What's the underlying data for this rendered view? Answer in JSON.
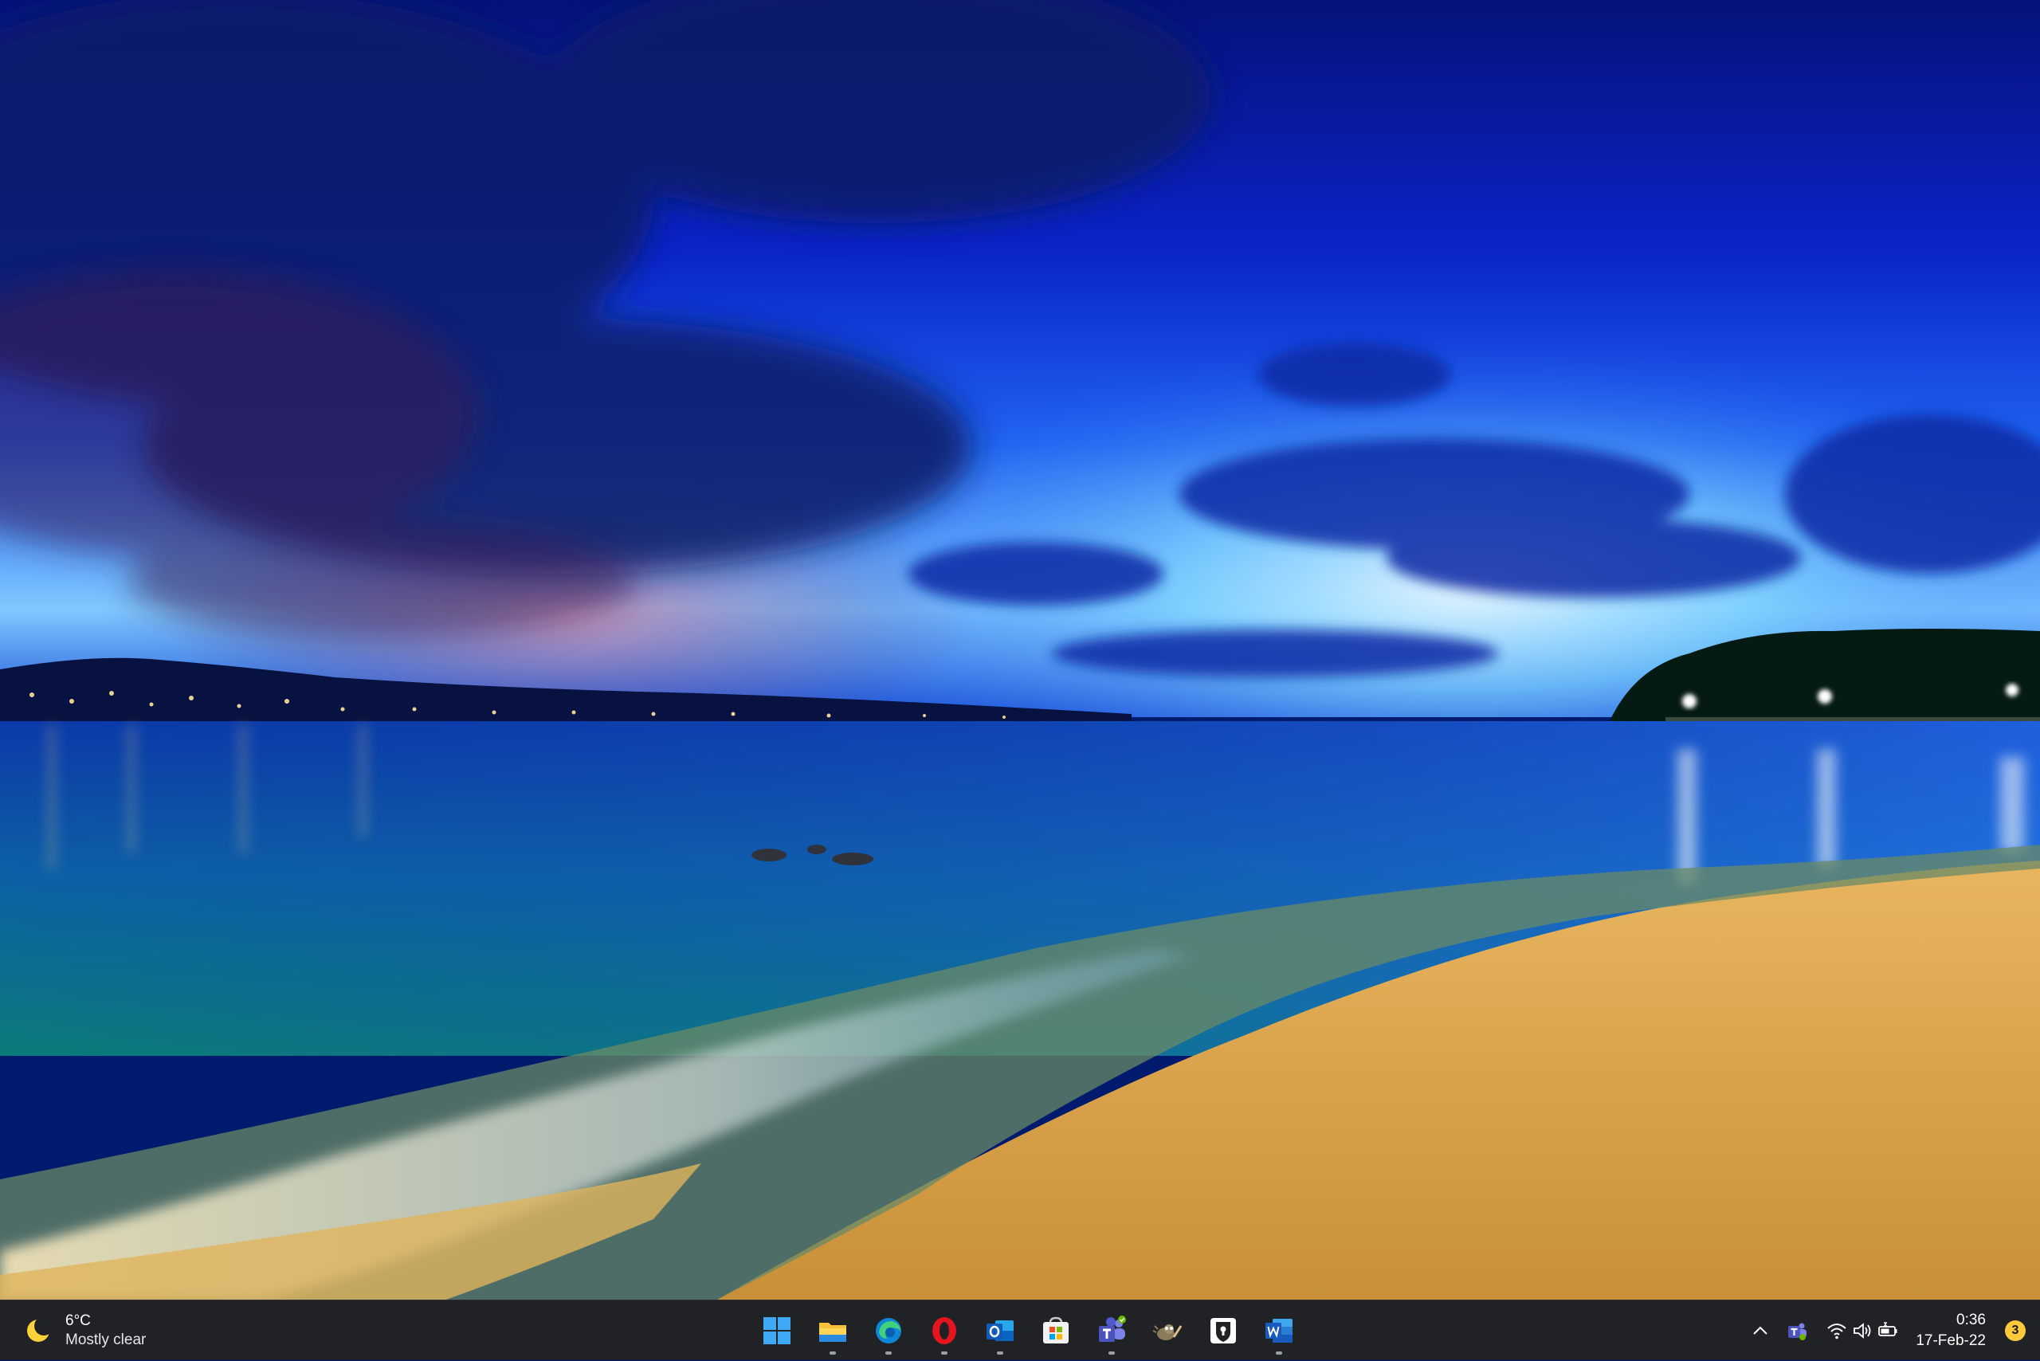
{
  "weather": {
    "temperature": "6°C",
    "condition": "Mostly clear",
    "icon": "crescent-moon-icon"
  },
  "taskbar": {
    "apps": [
      {
        "name": "Start",
        "icon": "windows-start-icon",
        "running": false
      },
      {
        "name": "File Explorer",
        "icon": "file-explorer-icon",
        "running": true
      },
      {
        "name": "Microsoft Edge",
        "icon": "edge-icon",
        "running": true
      },
      {
        "name": "Opera",
        "icon": "opera-icon",
        "running": true
      },
      {
        "name": "Outlook",
        "icon": "outlook-icon",
        "running": true
      },
      {
        "name": "Microsoft Store",
        "icon": "store-icon",
        "running": false
      },
      {
        "name": "Microsoft Teams",
        "icon": "teams-icon",
        "running": true
      },
      {
        "name": "GIMP",
        "icon": "gimp-icon",
        "running": false
      },
      {
        "name": "Bitwarden",
        "icon": "bitwarden-icon",
        "running": false
      },
      {
        "name": "Word",
        "icon": "word-icon",
        "running": true
      }
    ]
  },
  "tray": {
    "icons": [
      "chevron-up-icon",
      "teams-tray-icon",
      "wifi-icon",
      "volume-icon",
      "battery-icon"
    ],
    "time": "0:36",
    "date": "17-Feb-22",
    "notification_count": "3"
  },
  "colors": {
    "taskbar_bg": "#202225",
    "badge": "#ffc83d"
  }
}
